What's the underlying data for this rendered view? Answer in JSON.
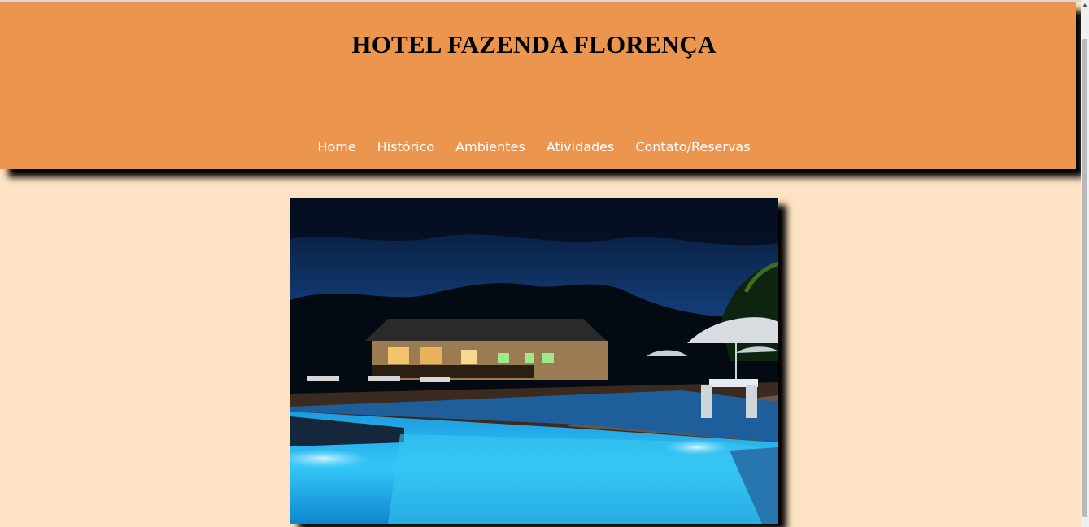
{
  "header": {
    "title": "HOTEL FAZENDA FLORENÇA",
    "background_color": "#ec954e"
  },
  "nav": {
    "items": [
      {
        "label": "Home"
      },
      {
        "label": "Histórico"
      },
      {
        "label": "Ambientes"
      },
      {
        "label": "Atividades"
      },
      {
        "label": "Contato/Reservas"
      }
    ]
  },
  "hero": {
    "icon": "hotel-pool-night-photo"
  },
  "page": {
    "background_color": "#fde3c3"
  }
}
